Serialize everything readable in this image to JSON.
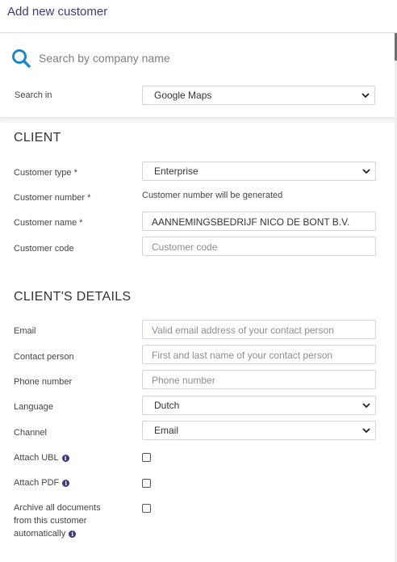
{
  "header": {
    "title": "Add new customer"
  },
  "search": {
    "placeholder": "Search by company name",
    "search_in_label": "Search in",
    "search_in_value": "Google Maps",
    "icon": "search-icon"
  },
  "client": {
    "title": "CLIENT",
    "customer_type_label": "Customer type *",
    "customer_type_value": "Enterprise",
    "customer_number_label": "Customer number *",
    "customer_number_value": "Customer number will be generated",
    "customer_name_label": "Customer name *",
    "customer_name_value": "AANNEMINGSBEDRIJF NICO DE BONT B.V.",
    "customer_code_label": "Customer code",
    "customer_code_placeholder": "Customer code"
  },
  "details": {
    "title": "CLIENT'S DETAILS",
    "email_label": "Email",
    "email_placeholder": "Valid email address of your contact person",
    "contact_label": "Contact person",
    "contact_placeholder": "First and last name of your contact person",
    "phone_label": "Phone number",
    "phone_placeholder": "Phone number",
    "language_label": "Language",
    "language_value": "Dutch",
    "channel_label": "Channel",
    "channel_value": "Email",
    "attach_ubl_label": "Attach UBL",
    "attach_pdf_label": "Attach PDF",
    "archive_line1": "Archive all documents",
    "archive_line2": "from this customer",
    "archive_line3": "automatically"
  },
  "colors": {
    "accent": "#3d3a7a",
    "search_icon": "#1e88c7",
    "border": "#d2d4d8",
    "background": "#f4f5f7"
  }
}
